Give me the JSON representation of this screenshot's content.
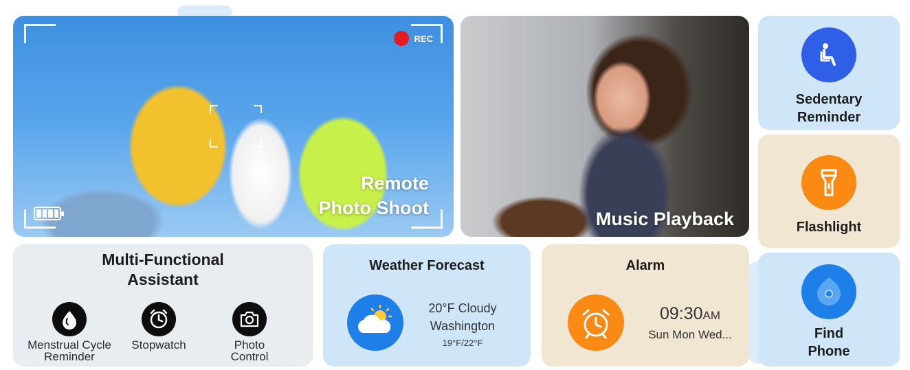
{
  "remote_photo": {
    "title_line1": "Remote",
    "title_line2": "Photo Shoot",
    "rec_label": "REC"
  },
  "music": {
    "title": "Music Playback"
  },
  "sedentary": {
    "label_line1": "Sedentary",
    "label_line2": "Reminder",
    "icon": "seated-person-icon",
    "color": "#2e5fe6"
  },
  "flashlight": {
    "label": "Flashlight",
    "icon": "flashlight-icon",
    "color": "#fb8a14"
  },
  "find_phone": {
    "label_line1": "Find",
    "label_line2": "Phone",
    "icon": "location-pin-icon",
    "color": "#1f7fe8"
  },
  "assistant": {
    "title_line1": "Multi-Functional",
    "title_line2": "Assistant",
    "items": [
      {
        "label_line1": "Menstrual Cycle",
        "label_line2": "Reminder",
        "icon": "drop-icon"
      },
      {
        "label_line1": "Stopwatch",
        "label_line2": "",
        "icon": "stopwatch-icon"
      },
      {
        "label_line1": "Photo",
        "label_line2": "Control",
        "icon": "camera-icon"
      }
    ]
  },
  "weather": {
    "title": "Weather Forecast",
    "condition": "20°F Cloudy",
    "city": "Washington",
    "range": "19°F/22°F",
    "icon": "partly-cloudy-icon"
  },
  "alarm": {
    "title": "Alarm",
    "time": "09:30",
    "ampm": "AM",
    "days": "Sun Mon Wed...",
    "icon": "alarm-clock-icon"
  }
}
